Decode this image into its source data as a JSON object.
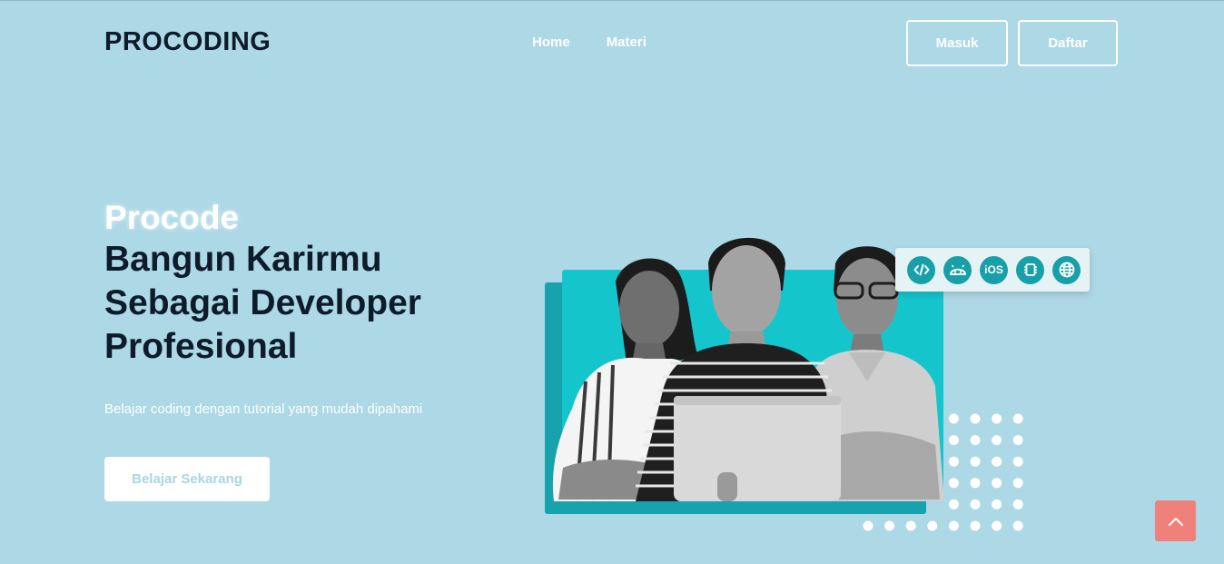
{
  "navbar": {
    "brand": "PROCODING",
    "links": [
      {
        "label": "Home"
      },
      {
        "label": "Materi"
      }
    ],
    "login_label": "Masuk",
    "register_label": "Daftar"
  },
  "hero": {
    "accent_title": "Procode",
    "title_lines": [
      "Bangun Karirmu",
      "Sebagai Developer",
      "Profesional"
    ],
    "subtitle": "Belajar coding dengan tutorial yang mudah dipahami",
    "cta_label": "Belajar Sekarang"
  },
  "tech_icons": [
    {
      "name": "code-icon",
      "glyph": ""
    },
    {
      "name": "android-icon",
      "glyph": ""
    },
    {
      "name": "ios-icon",
      "glyph": "iOS"
    },
    {
      "name": "chip-icon",
      "glyph": ""
    },
    {
      "name": "globe-icon",
      "glyph": ""
    }
  ],
  "colors": {
    "background": "#add8e6",
    "text_dark": "#0d1b2a",
    "teal_dark": "#17a3ad",
    "teal_light": "#14c6cc",
    "scroll_button": "#f0817a"
  }
}
